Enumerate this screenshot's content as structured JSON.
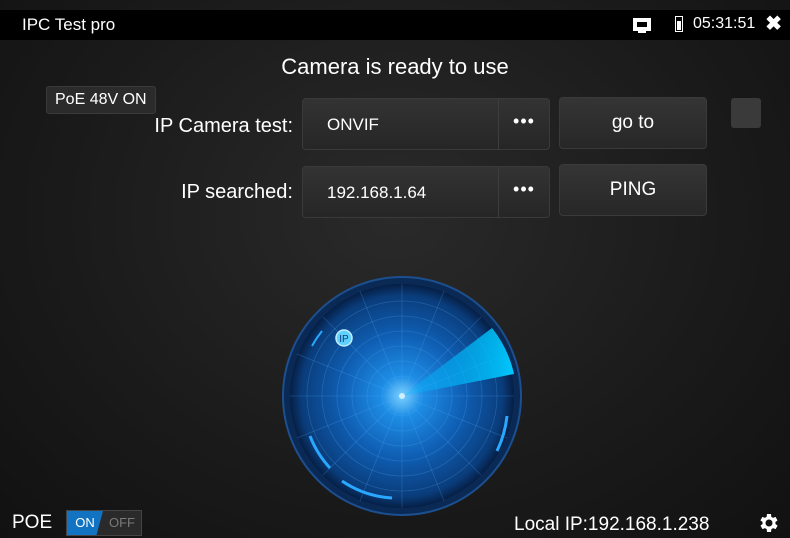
{
  "titlebar": {
    "app_title": "IPC Test pro",
    "time": "05:31:51",
    "icons": [
      "monitor-icon",
      "battery-icon",
      "close-icon"
    ]
  },
  "headline": "Camera is ready to use",
  "poe_badge": "PoE 48V ON",
  "camera_test": {
    "label": "IP Camera test:",
    "value": "ONVIF",
    "more": "•••",
    "button": "go to"
  },
  "ip_search": {
    "label": "IP searched:",
    "value": "192.168.1.64",
    "more": "•••",
    "button": "PING"
  },
  "radar": {
    "marker": "IP",
    "colors": {
      "accent": "#1aa6ff",
      "sweep": "#00b7ff"
    }
  },
  "footer": {
    "poe_label": "POE",
    "toggle_on": "ON",
    "toggle_off": "OFF",
    "local_ip": "Local IP:192.168.1.238"
  }
}
